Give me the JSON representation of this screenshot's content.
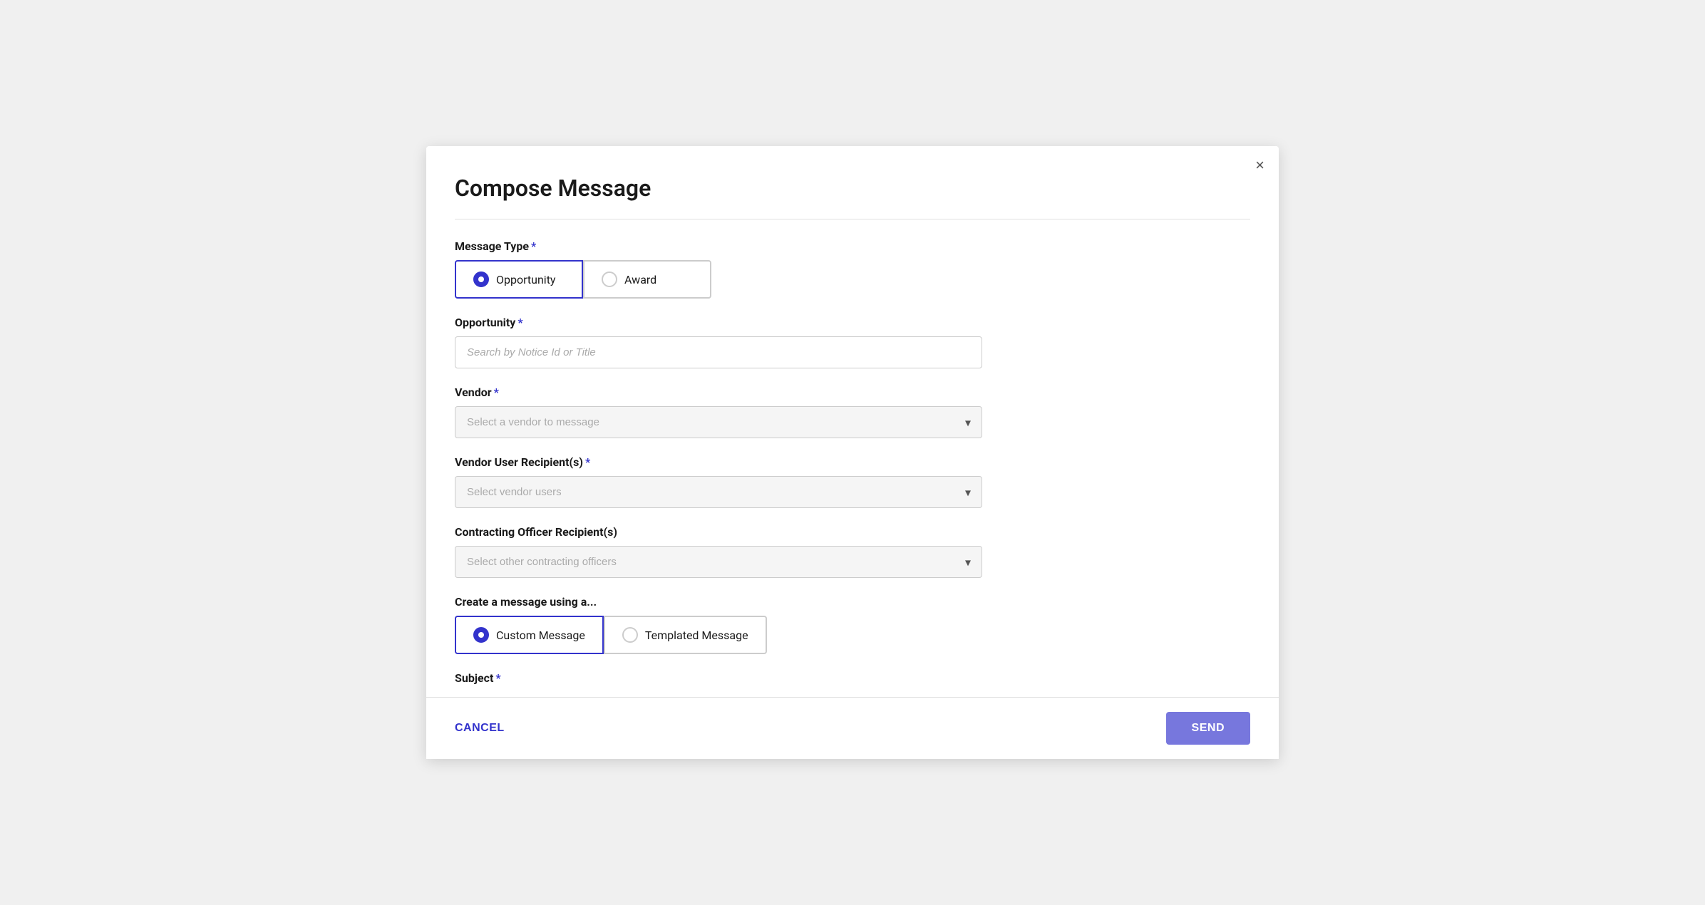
{
  "modal": {
    "title": "Compose Message",
    "close_label": "×"
  },
  "message_type_label": "Message Type",
  "message_type_options": [
    {
      "id": "opportunity",
      "label": "Opportunity",
      "selected": true
    },
    {
      "id": "award",
      "label": "Award",
      "selected": false
    }
  ],
  "opportunity_label": "Opportunity",
  "opportunity_placeholder": "Search by Notice Id or Title",
  "vendor_label": "Vendor",
  "vendor_placeholder": "Select a vendor to message",
  "vendor_users_label": "Vendor User Recipient(s)",
  "vendor_users_placeholder": "Select vendor users",
  "contracting_officer_label": "Contracting Officer Recipient(s)",
  "contracting_officer_placeholder": "Select other contracting officers",
  "create_message_label": "Create a message using a...",
  "message_style_options": [
    {
      "id": "custom",
      "label": "Custom Message",
      "selected": true
    },
    {
      "id": "templated",
      "label": "Templated Message",
      "selected": false
    }
  ],
  "subject_label": "Subject",
  "footer": {
    "cancel_label": "CANCEL",
    "send_label": "SEND"
  }
}
